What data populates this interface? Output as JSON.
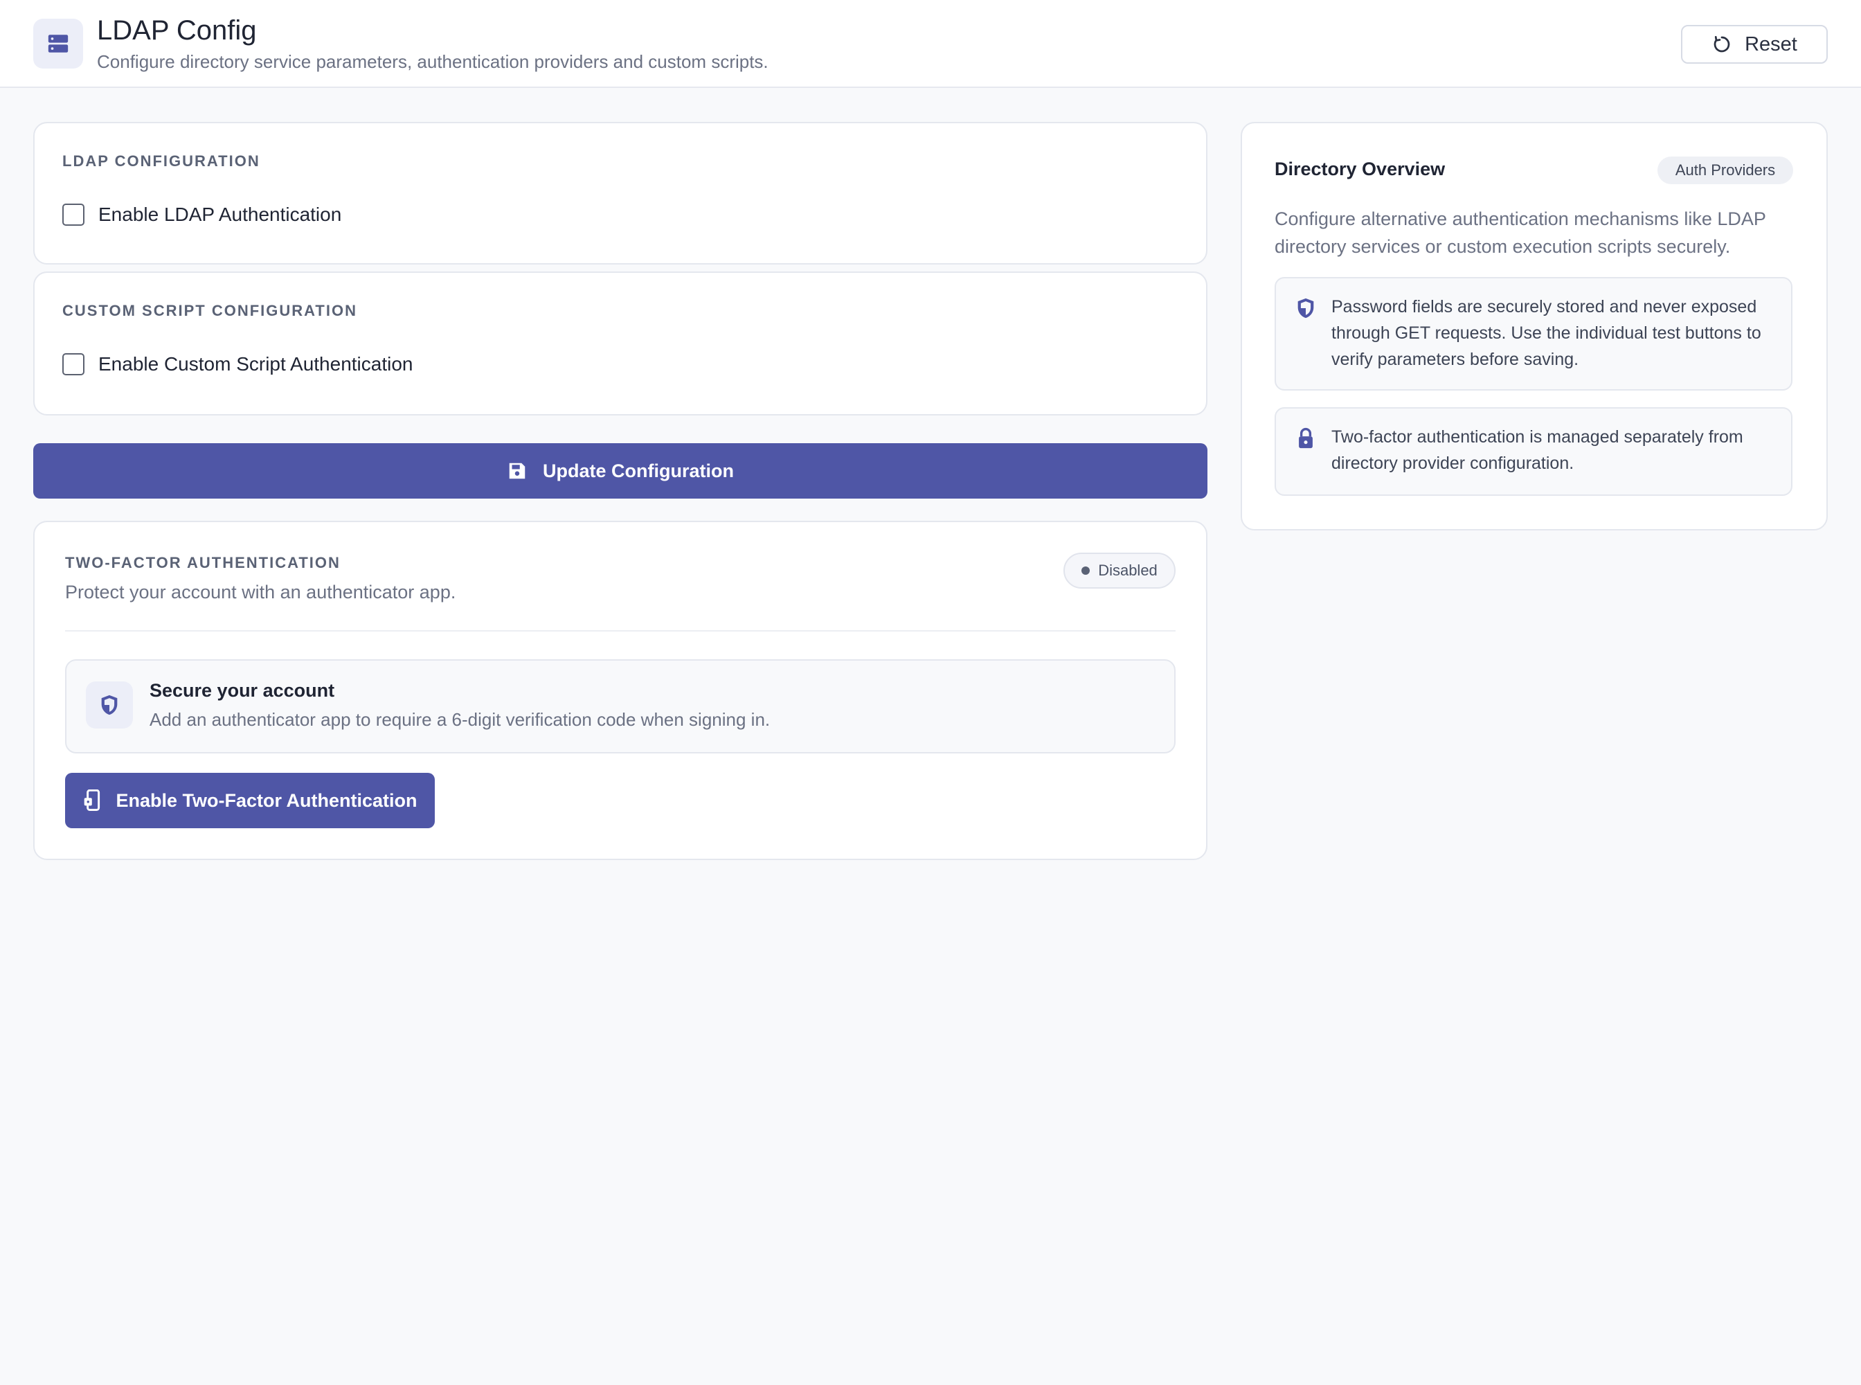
{
  "header": {
    "title": "LDAP Config",
    "subtitle": "Configure directory service parameters, authentication providers and custom scripts.",
    "icon": "server-icon",
    "reset_label": "Reset"
  },
  "ldap": {
    "section_title": "LDAP CONFIGURATION",
    "checkbox_label": "Enable LDAP Authentication",
    "checked": false
  },
  "custom_script": {
    "section_title": "CUSTOM SCRIPT CONFIGURATION",
    "checkbox_label": "Enable Custom Script Authentication",
    "checked": false
  },
  "update_button": {
    "label": "Update Configuration",
    "icon": "save-icon"
  },
  "two_factor": {
    "section_title": "TWO-FACTOR AUTHENTICATION",
    "description": "Protect your account with an authenticator app.",
    "status": "Disabled",
    "info_title": "Secure your account",
    "info_text": "Add an authenticator app to require a 6-digit verification code when signing in.",
    "enable_label": "Enable Two-Factor Authentication"
  },
  "overview": {
    "title": "Directory Overview",
    "badge": "Auth Providers",
    "description": "Configure alternative authentication mechanisms like LDAP directory services or custom execution scripts securely.",
    "notes": [
      {
        "icon": "shield-icon",
        "text": "Password fields are securely stored and never exposed through GET requests. Use the individual test buttons to verify parameters before saving."
      },
      {
        "icon": "lock-icon",
        "text": "Two-factor authentication is managed separately from directory provider configuration."
      }
    ]
  },
  "colors": {
    "accent": "#4f56a6",
    "background": "#f8f9fb",
    "card": "#ffffff",
    "border": "#e4e7ee",
    "muted_text": "#6b7183"
  }
}
